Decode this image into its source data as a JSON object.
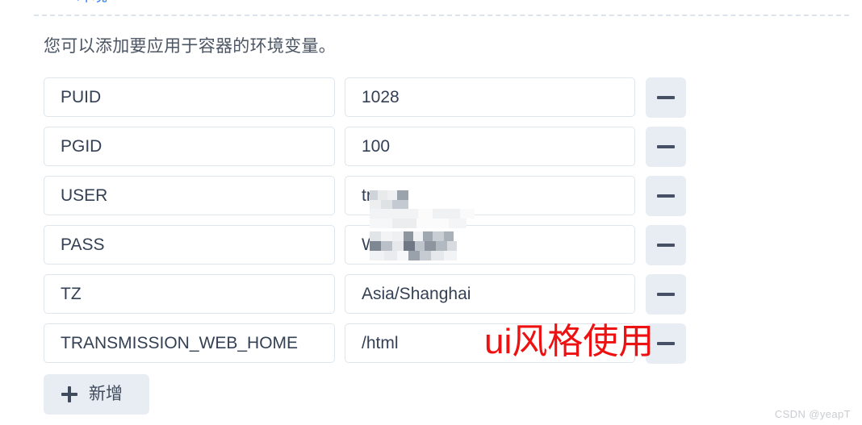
{
  "tabs": {
    "active_label": "环境"
  },
  "description": "您可以添加要应用于容器的环境变量。",
  "env_table": {
    "rows": [
      {
        "name": "PUID",
        "value": "1028",
        "redacted": false,
        "remove_label": "−"
      },
      {
        "name": "PGID",
        "value": "100",
        "redacted": false,
        "remove_label": "−"
      },
      {
        "name": "USER",
        "value": "tr",
        "redacted": true,
        "remove_label": "−"
      },
      {
        "name": "PASS",
        "value": "W",
        "redacted": true,
        "remove_label": "−"
      },
      {
        "name": "TZ",
        "value": "Asia/Shanghai",
        "redacted": false,
        "remove_label": "−"
      },
      {
        "name": "TRANSMISSION_WEB_HOME",
        "value": "/html",
        "redacted": false,
        "remove_label": "−"
      }
    ]
  },
  "add_button": {
    "label": "新增",
    "icon": "plus-icon"
  },
  "annotation": {
    "text": "ui风格使用",
    "color": "#ee1111"
  },
  "watermark": "CSDN @yeapT",
  "colors": {
    "tab_active": "#1f7bff",
    "text": "#344054",
    "description": "#4b5563",
    "input_border": "#dfe5ec",
    "button_bg": "#e8edf3",
    "annotation": "#ee1111"
  }
}
